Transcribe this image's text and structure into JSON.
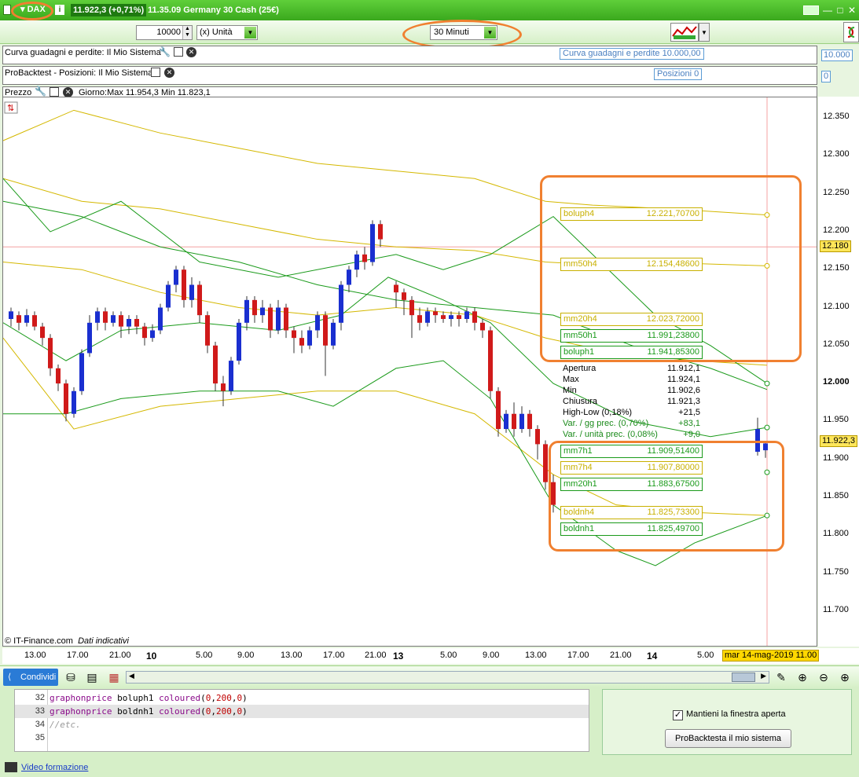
{
  "titlebar": {
    "ticker": "▾ DAX",
    "price": "11.922,3 (+0,71%)",
    "time_instrument": "11.35.09 Germany 30 Cash (25€)",
    "minimize": "—",
    "maximize": "□",
    "close": "✕"
  },
  "toolbar": {
    "quantity": "10000",
    "unit": "(x) Unità",
    "timeframe": "30 Minuti"
  },
  "panels": {
    "equity": {
      "label": "Curva guadagni e perdite: Il Mio Sistema",
      "tag": "Curva guadagni e perdite   10.000,00",
      "axis": "10.000"
    },
    "positions": {
      "label": "ProBacktest - Posizioni: Il Mio Sistema",
      "tag": "Posizioni   0",
      "axis": "0"
    },
    "price": {
      "label": "Prezzo",
      "day_info": "Giorno:Max 11.954,3 Min 11.823,1"
    }
  },
  "chart": {
    "y_labels": [
      "12.350",
      "12.300",
      "12.250",
      "12.200",
      "12.150",
      "12.100",
      "12.050",
      "12.000",
      "11.950",
      "11.900",
      "11.850",
      "11.800",
      "11.750",
      "11.700"
    ],
    "y_marker_12180": "12.180",
    "current_price_tag": "11.922,3",
    "x_labels": [
      {
        "t": "13.00",
        "b": false
      },
      {
        "t": "17.00",
        "b": false
      },
      {
        "t": "21.00",
        "b": false
      },
      {
        "t": "10",
        "b": true
      },
      {
        "t": "5.00",
        "b": false
      },
      {
        "t": "9.00",
        "b": false
      },
      {
        "t": "13.00",
        "b": false
      },
      {
        "t": "17.00",
        "b": false
      },
      {
        "t": "21.00",
        "b": false
      },
      {
        "t": "13",
        "b": true
      },
      {
        "t": "5.00",
        "b": false
      },
      {
        "t": "9.00",
        "b": false
      },
      {
        "t": "13.00",
        "b": false
      },
      {
        "t": "17.00",
        "b": false
      },
      {
        "t": "21.00",
        "b": false
      },
      {
        "t": "14",
        "b": true
      },
      {
        "t": "5.00",
        "b": false
      }
    ],
    "date_tag": "mar 14-mag-2019 11.00",
    "copyright": "© IT-Finance.com",
    "copyright_note": "Dati indicativi",
    "legend_top": [
      {
        "name": "boluph4",
        "value": "12.221,70700",
        "color": "#c8b000"
      },
      {
        "name": "mm50h4",
        "value": "12.154,48600",
        "color": "#c8b000"
      },
      {
        "name": "mm20h4",
        "value": "12.023,72000",
        "color": "#c8b000"
      },
      {
        "name": "mm50h1",
        "value": "11.991,23800",
        "color": "#1a9a1a"
      },
      {
        "name": "boluph1",
        "value": "11.941,85300",
        "color": "#1a9a1a"
      }
    ],
    "ohlc": [
      {
        "k": "Apertura",
        "v": "11.912,1",
        "c": "#000"
      },
      {
        "k": "Max",
        "v": "11.924,1",
        "c": "#000"
      },
      {
        "k": "Min",
        "v": "11.902,6",
        "c": "#000"
      },
      {
        "k": "Chiusura",
        "v": "11.921,3",
        "c": "#000"
      },
      {
        "k": "High-Low (0,18%)",
        "v": "+21,5",
        "c": "#000"
      },
      {
        "k": "Var. / gg prec. (0,70%)",
        "v": "+83,1",
        "c": "#1a8a1a"
      },
      {
        "k": "Var. / unità prec. (0,08%)",
        "v": "+9,0",
        "c": "#1a8a1a"
      }
    ],
    "legend_bottom": [
      {
        "name": "mm7h1",
        "value": "11.909,51400",
        "color": "#1a9a1a"
      },
      {
        "name": "mm7h4",
        "value": "11.907,80000",
        "color": "#c8b000"
      },
      {
        "name": "mm20h1",
        "value": "11.883,67500",
        "color": "#1a9a1a"
      },
      {
        "name": "boldnh4",
        "value": "11.825,73300",
        "color": "#c8b000"
      },
      {
        "name": "boldnh1",
        "value": "11.825,49700",
        "color": "#1a9a1a"
      }
    ]
  },
  "bottombar": {
    "share": "Condividi"
  },
  "editor": {
    "lines": [
      {
        "n": "32",
        "kw": "graphonprice",
        "name": " boluph1 ",
        "kw2": "coloured",
        "args": [
          "0",
          "200",
          "0"
        ]
      },
      {
        "n": "33",
        "kw": "graphonprice",
        "name": " boldnh1 ",
        "kw2": "coloured",
        "args": [
          "0",
          "200",
          "0"
        ]
      },
      {
        "n": "34",
        "comment": "//etc."
      },
      {
        "n": "35"
      }
    ]
  },
  "rightbox": {
    "checkbox_label": "Mantieni la finestra aperta",
    "checkbox_checked": "✓",
    "run_button": "ProBacktesta il mio sistema"
  },
  "footer": {
    "video_link": "Video formazione"
  }
}
